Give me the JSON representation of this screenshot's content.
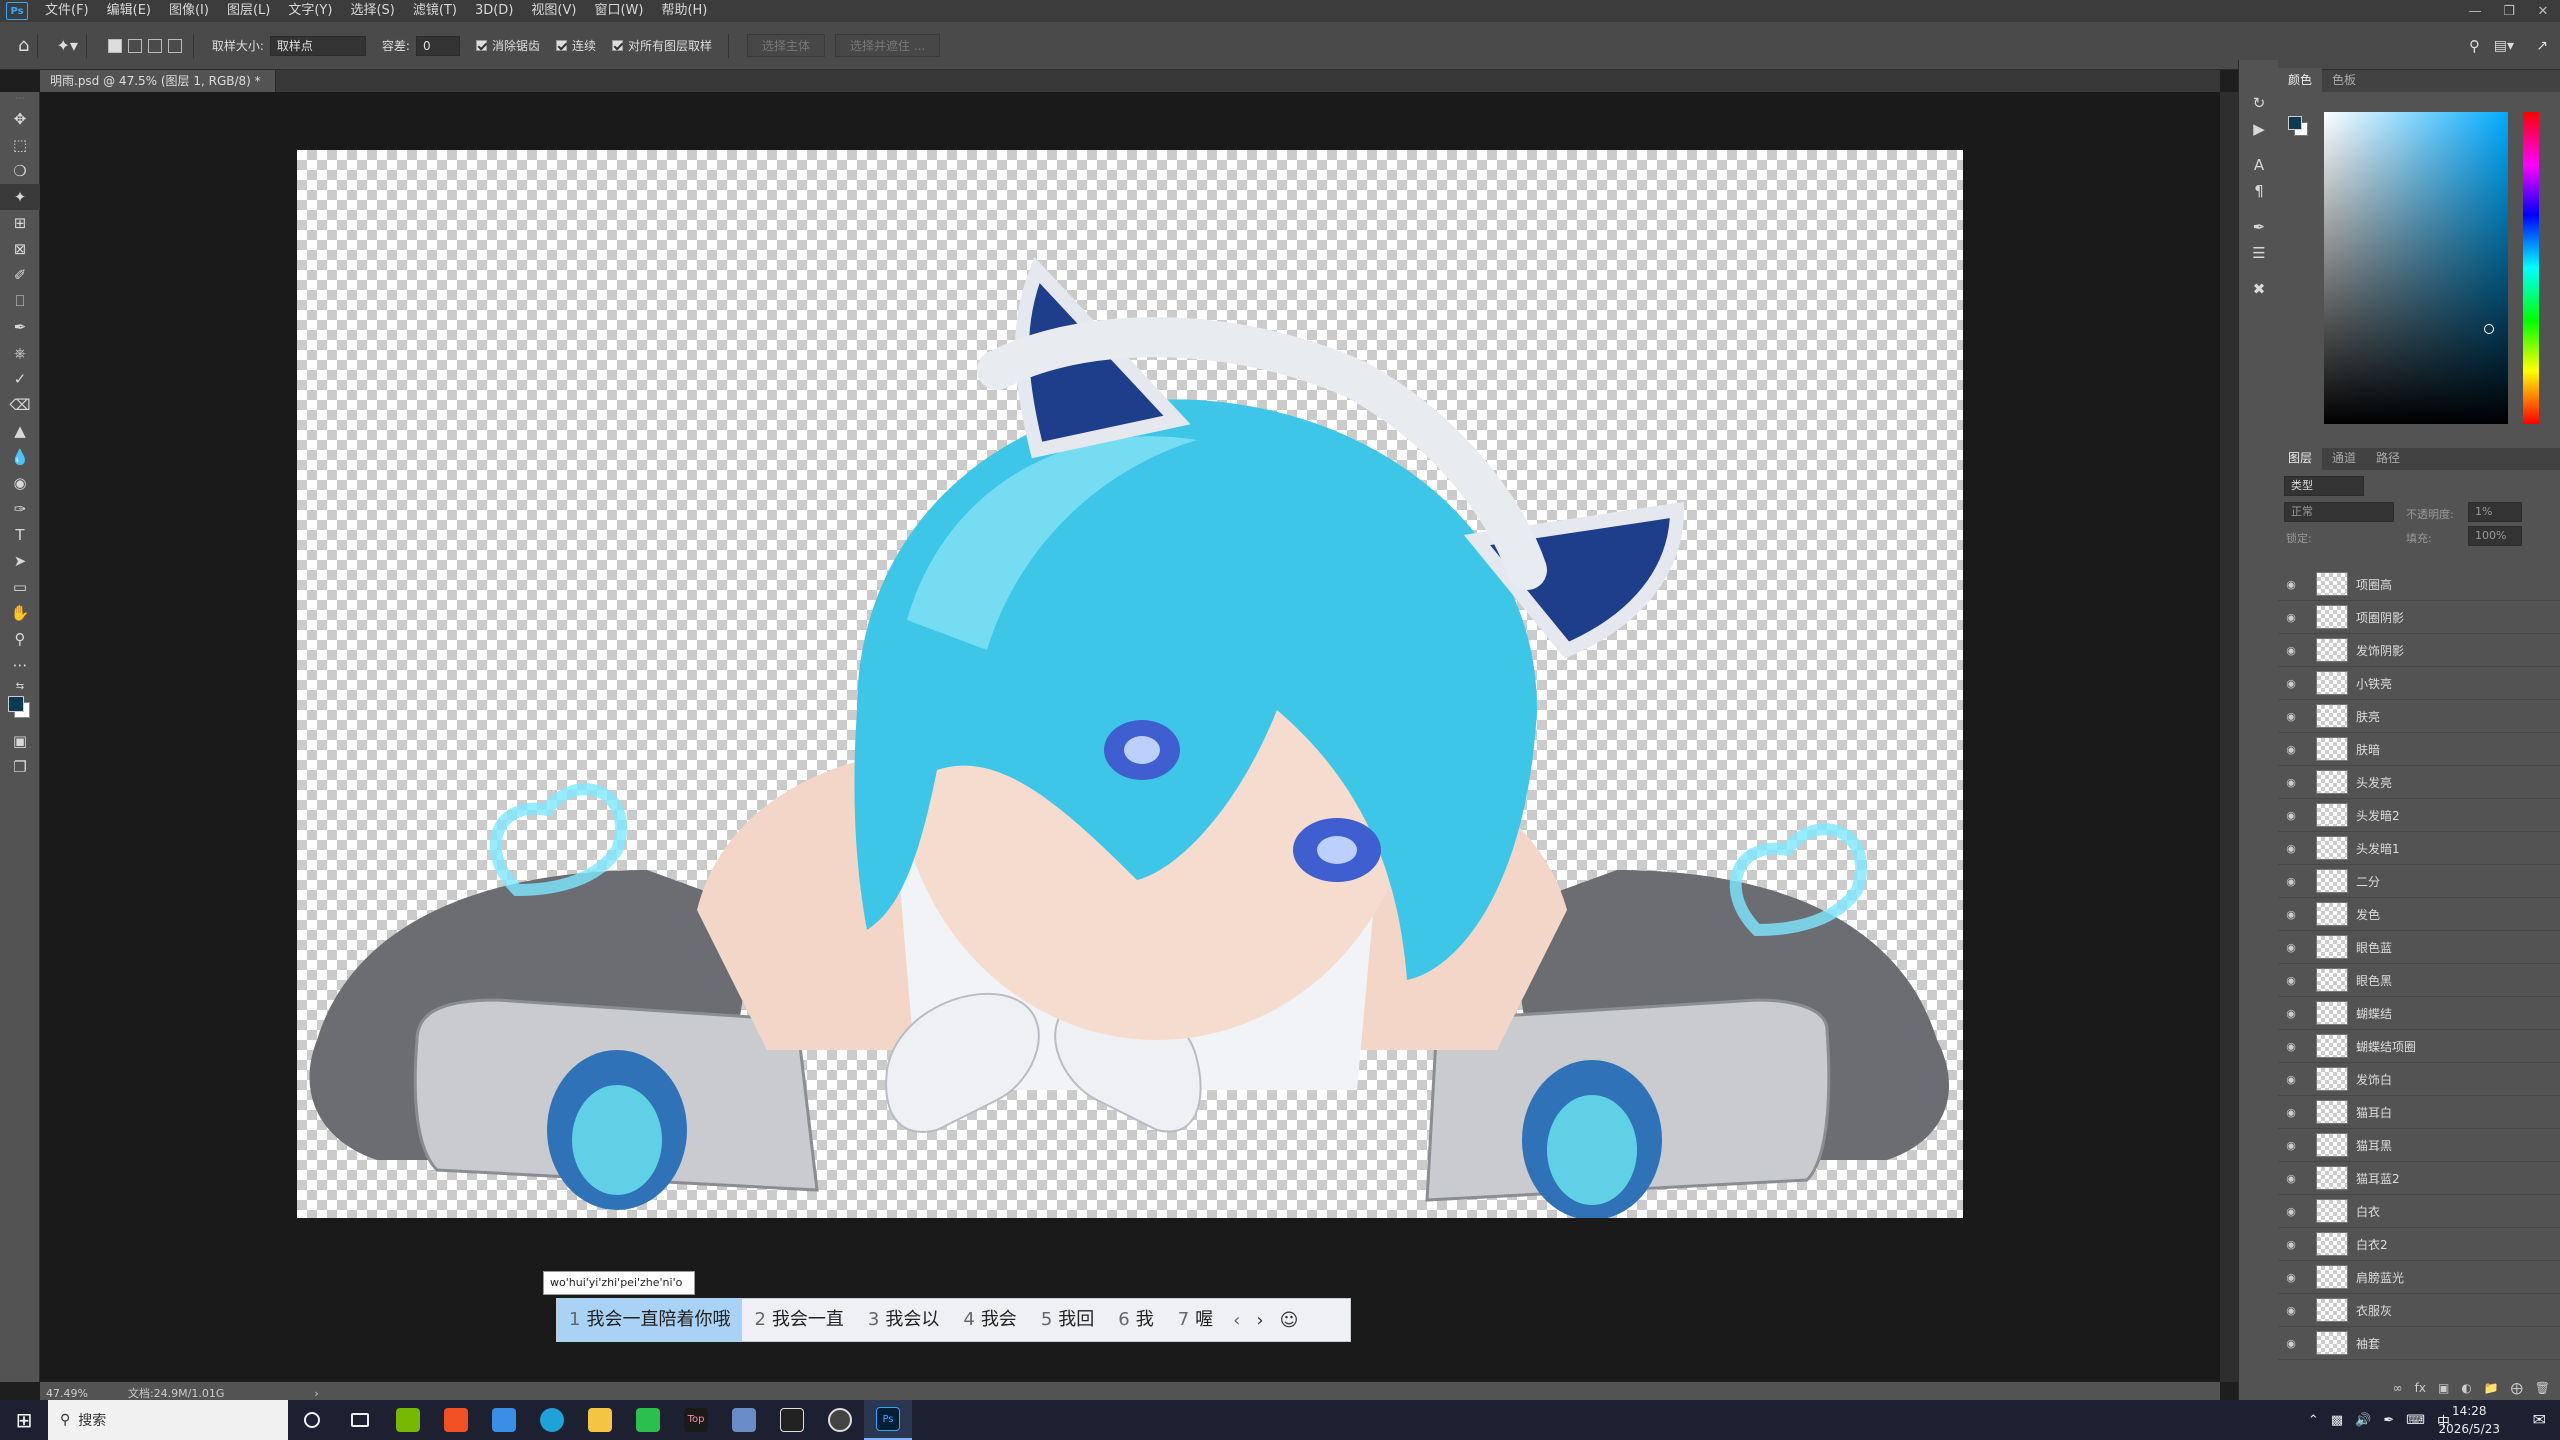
{
  "menubar": {
    "items": [
      "文件(F)",
      "编辑(E)",
      "图像(I)",
      "图层(L)",
      "文字(Y)",
      "选择(S)",
      "滤镜(T)",
      "3D(D)",
      "视图(V)",
      "窗口(W)",
      "帮助(H)"
    ]
  },
  "options": {
    "sample_size_label": "取样大小:",
    "sample_size_value": "取样点",
    "tolerance_label": "容差:",
    "tolerance_value": "0",
    "antialias": "消除锯齿",
    "contiguous": "连续",
    "sample_all": "对所有图层取样",
    "select_subject": "选择主体",
    "select_mask": "选择并遮住 ..."
  },
  "document": {
    "tab_title": "明雨.psd @ 47.5% (图层 1, RGB/8) *"
  },
  "status": {
    "zoom": "47.49%",
    "doc": "文档:24.9M/1.01G"
  },
  "panels": {
    "color_tabs": [
      "颜色",
      "色板"
    ],
    "layer_tabs": [
      "图层",
      "通道",
      "路径"
    ],
    "kind": "类型",
    "blend": "正常",
    "opacity_label": "不透明度:",
    "opacity": "1%",
    "lock_label": "锁定:",
    "fill_label": "填充:",
    "fill": "100%"
  },
  "layers": [
    "项圈高",
    "项圈阴影",
    "发饰阴影",
    "小铁亮",
    "肤亮",
    "肤暗",
    "头发亮",
    "头发暗2",
    "头发暗1",
    "二分",
    "发色",
    "眼色蓝",
    "眼色黑",
    "蝴蝶结",
    "蝴蝶结项圈",
    "发饰白",
    "猫耳白",
    "猫耳黑",
    "猫耳蓝2",
    "白衣",
    "白衣2",
    "肩膀蓝光",
    "衣服灰",
    "袖套"
  ],
  "ime": {
    "composition": "wo'hui'yi'zhi'pei'zhe'ni'o",
    "candidates": [
      {
        "n": "1",
        "text": "我会一直陪着你哦"
      },
      {
        "n": "2",
        "text": "我会一直"
      },
      {
        "n": "3",
        "text": "我会以"
      },
      {
        "n": "4",
        "text": "我会"
      },
      {
        "n": "5",
        "text": "我回"
      },
      {
        "n": "6",
        "text": "我"
      },
      {
        "n": "7",
        "text": "喔"
      }
    ]
  },
  "taskbar": {
    "search": "搜索",
    "time": "14:28",
    "date": "2026/5/23",
    "lang": "中"
  },
  "colors": {
    "accent": "#31a8ff",
    "fg_swatch": "#0e3a52"
  }
}
